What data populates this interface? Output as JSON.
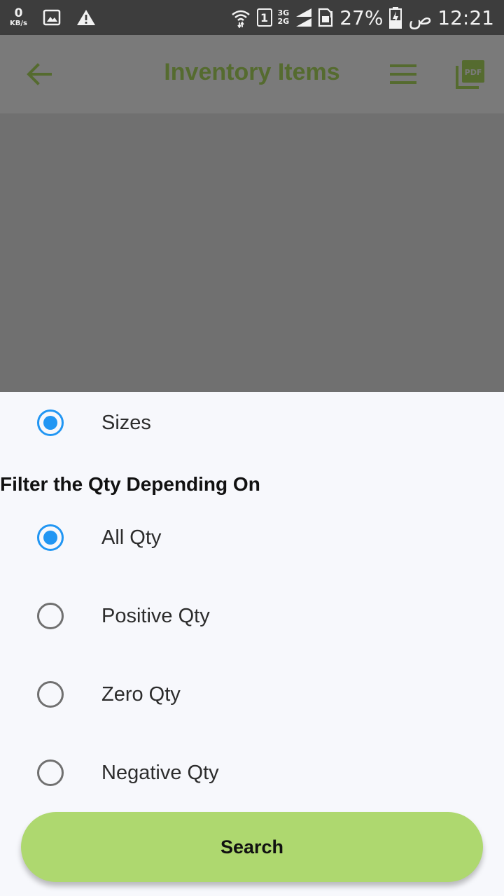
{
  "status_bar": {
    "speed_value": "0",
    "speed_unit": "KB/s",
    "sim_slot": "1",
    "net_top": "3G",
    "net_bottom": "2G",
    "battery": "27%",
    "ampm": "ص",
    "time": "12:21"
  },
  "app_bar": {
    "title": "Inventory Items",
    "accent_color": "#556b2f"
  },
  "sheet": {
    "group_option": {
      "label": "Sizes",
      "selected": true
    },
    "filter_title": "Filter the Qty Depending On",
    "qty_options": [
      {
        "label": "All Qty",
        "selected": true
      },
      {
        "label": "Positive Qty",
        "selected": false
      },
      {
        "label": "Zero Qty",
        "selected": false
      },
      {
        "label": "Negative Qty",
        "selected": false
      }
    ],
    "search_label": "Search",
    "radio_color": "#2196f3",
    "button_color": "#aed86f"
  },
  "icons": [
    "back-arrow-icon",
    "menu-icon",
    "pdf-icon",
    "image-icon",
    "warning-icon",
    "wifi-icon",
    "signal-icon",
    "sim-card-icon",
    "battery-icon"
  ]
}
